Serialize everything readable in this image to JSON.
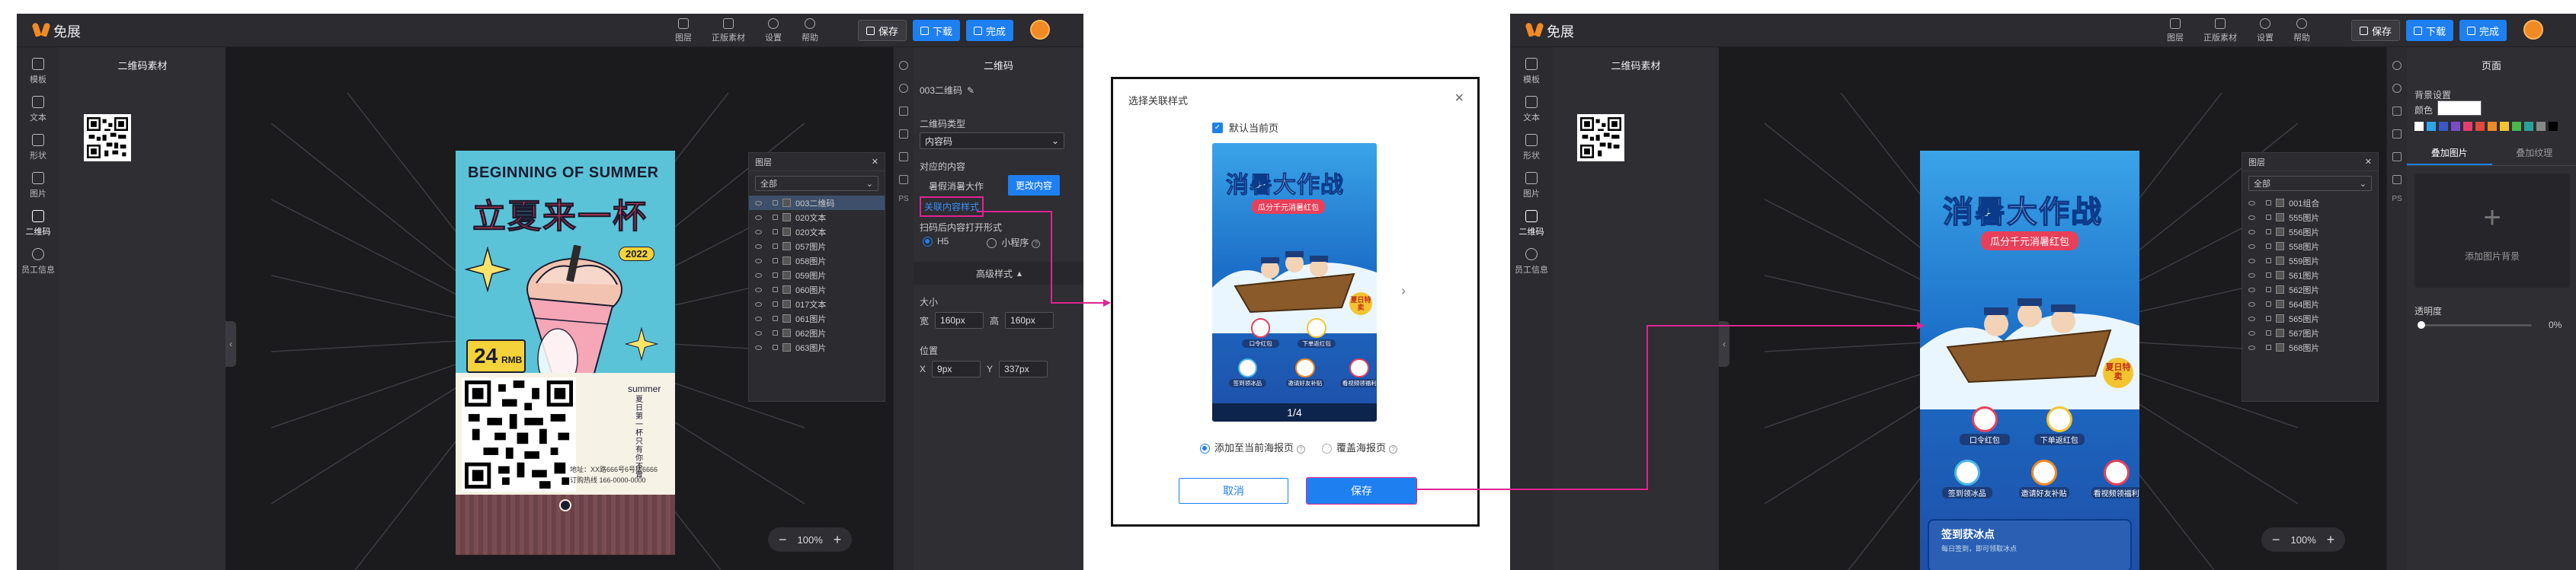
{
  "app": {
    "brand": "免展",
    "toolbar": [
      "图层",
      "正版素材",
      "设置",
      "帮助"
    ],
    "btn_save": "保存",
    "btn_download": "下载",
    "btn_done": "完成",
    "side_nav": [
      "模板",
      "文本",
      "形状",
      "图片",
      "二维码",
      "员工信息"
    ],
    "zoom": "100%",
    "layer_filter": "全部",
    "layers_title": "图层"
  },
  "left_editor": {
    "panel_title": "二维码素材",
    "poster": {
      "en_title": "BEGINNING OF SUMMER",
      "cn_title": "立夏来一杯",
      "year": "2022",
      "price": "24",
      "price_unit": "RMB",
      "side_en": "summer",
      "side_cn": "夏日第一杯 只有你不曾",
      "address": "地址：XX路666号6号楼6666",
      "hotline": "订购热线 166-0000-0000"
    },
    "layers": [
      "003二维码",
      "020文本",
      "020文本",
      "057图片",
      "058图片",
      "059图片",
      "060图片",
      "017文本",
      "061图片",
      "062图片",
      "063图片"
    ],
    "right_panel": {
      "title": "二维码",
      "name": "003二维码",
      "type_label": "二维码类型",
      "type_value": "内容码",
      "content_label": "对应的内容",
      "content_value": "暑假消暑大作",
      "change_btn": "更改内容",
      "style_link": "关联内容样式",
      "open_label": "扫码后内容打开形式",
      "open_h5": "H5",
      "open_mini": "小程序",
      "advanced": "高级样式",
      "size_label": "大小",
      "w_label": "宽",
      "w_value": "160px",
      "h_label": "高",
      "h_value": "160px",
      "pos_label": "位置",
      "x_label": "X",
      "x_value": "9px",
      "y_label": "Y",
      "y_value": "337px"
    }
  },
  "modal": {
    "title": "选择关联样式",
    "checkbox_label": "默认当前页",
    "pager": "1/4",
    "radio_add": "添加至当前海报页",
    "radio_cover": "覆盖海报页",
    "cancel": "取消",
    "save": "保存"
  },
  "poster_war": {
    "title": "消暑大作战",
    "subtitle": "瓜分千元消暑红包",
    "badge": "夏日特卖",
    "items": [
      "口令红包",
      "下单返红包",
      "签到领冰品",
      "邀请好友补贴",
      "看视频领福利"
    ],
    "signin": "签到获冰点",
    "signin_sub": "每日签到，即可领取冰点"
  },
  "right_editor": {
    "panel_title": "二维码素材",
    "layers": [
      "001组合",
      "555图片",
      "556图片",
      "558图片",
      "559图片",
      "561图片",
      "562图片",
      "564图片",
      "565图片",
      "567图片",
      "568图片"
    ],
    "right_panel": {
      "title": "页面",
      "bg_label": "背景设置",
      "color_label": "颜色",
      "tab_overlay_img": "叠加图片",
      "tab_overlay_tex": "叠加纹理",
      "add_bg": "添加图片背景",
      "opacity_label": "透明度",
      "opacity_value": "0%",
      "opacity": 0
    }
  },
  "colors": {
    "accent": "#1e7ff0",
    "annotation": "#e02490",
    "brand": "#f08a24",
    "palette": [
      "#ffffff",
      "#2ea6e8",
      "#3a58c6",
      "#7a4cc8",
      "#e0406e",
      "#e04a3a",
      "#f08a24",
      "#f4c430",
      "#4cb84c",
      "#2aa198",
      "#888888",
      "#000000"
    ]
  }
}
